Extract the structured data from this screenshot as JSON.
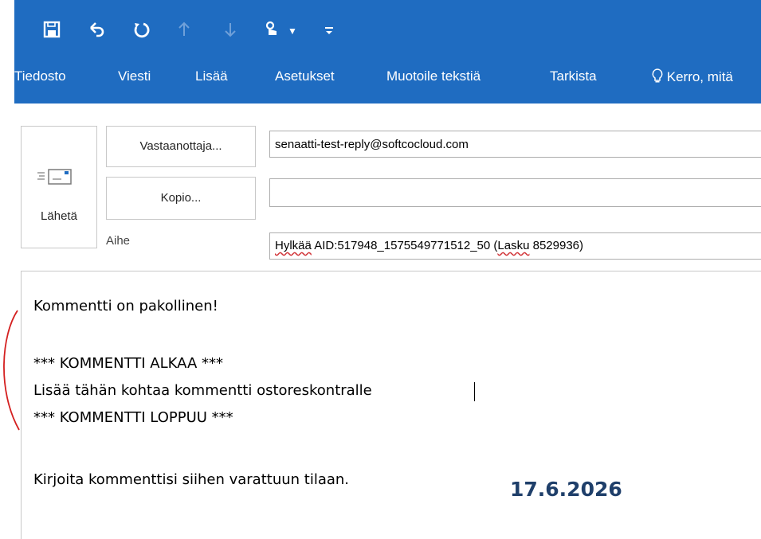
{
  "quick_access": {
    "save_icon": "save-icon",
    "undo_icon": "undo-icon",
    "redo_icon": "redo-icon",
    "up_icon": "arrow-up-icon",
    "down_icon": "arrow-down-icon",
    "touch_icon": "touch-mode-icon",
    "more_icon": "customize-icon"
  },
  "ribbon_tabs": [
    "Tiedosto",
    "Viesti",
    "Lisää",
    "Asetukset",
    "Muotoile tekstiä",
    "Tarkista",
    "Kerro, mitä"
  ],
  "header": {
    "send_label": "Lähetä",
    "to_button": "Vastaanottaja...",
    "to_value": "senaatti-test-reply@softcocloud.com",
    "cc_button": "Kopio...",
    "cc_value": "",
    "subject_label": "Aihe",
    "subject_word": "Hylkää",
    "subject_mid": " AID:517948_1575549771512_50 (",
    "subject_word2": "Lasku",
    "subject_end": " 8529936)"
  },
  "body_lines": [
    "Kommentti on pakollinen!",
    "*** KOMMENTTI ALKAA ***",
    "Lisää tähän kohtaa kommentti ostoreskontralle",
    "*** KOMMENTTI LOPPUU ***",
    "Kirjoita kommenttisi siihen varattuun tilaan."
  ],
  "date_stamp": "17.6.2026",
  "colors": {
    "ribbon": "#1f6cc1",
    "date": "#1f3f6a",
    "annotation": "#d42020"
  }
}
